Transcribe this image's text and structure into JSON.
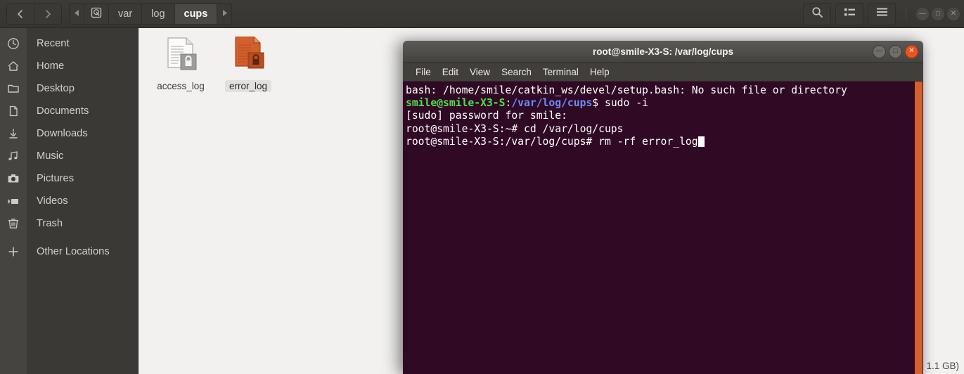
{
  "file_manager": {
    "nav": {
      "back_label": "Back",
      "forward_label": "Forward",
      "back_icon": "chevron-left-icon",
      "forward_icon": "chevron-right-icon"
    },
    "breadcrumb": {
      "scroll_left_icon": "triangle-left-icon",
      "scroll_right_icon": "triangle-right-icon",
      "root_icon": "drive-icon",
      "items": [
        {
          "label": "var",
          "active": false
        },
        {
          "label": "log",
          "active": false
        },
        {
          "label": "cups",
          "active": true
        }
      ]
    },
    "toolbar": {
      "search_icon": "search-icon",
      "view_list_icon": "view-list-icon",
      "menu_icon": "hamburger-menu-icon",
      "window_minimize": "—",
      "window_maximize": "□",
      "window_close": "✕"
    },
    "sidebar": {
      "items": [
        {
          "label": "Recent",
          "icon": "clock-icon"
        },
        {
          "label": "Home",
          "icon": "home-icon"
        },
        {
          "label": "Desktop",
          "icon": "folder-icon"
        },
        {
          "label": "Documents",
          "icon": "document-icon"
        },
        {
          "label": "Downloads",
          "icon": "download-icon"
        },
        {
          "label": "Music",
          "icon": "music-note-icon"
        },
        {
          "label": "Pictures",
          "icon": "camera-icon"
        },
        {
          "label": "Videos",
          "icon": "video-icon"
        },
        {
          "label": "Trash",
          "icon": "trash-icon"
        },
        {
          "label": "Other Locations",
          "icon": "plus-icon"
        }
      ]
    },
    "files": [
      {
        "name": "access_log",
        "type": "locked-text-file",
        "color": "#b7b5b0",
        "selected": false
      },
      {
        "name": "error_log",
        "type": "locked-text-file",
        "color": "#d35f2c",
        "selected": true
      }
    ],
    "status_text": "1.1 GB)"
  },
  "terminal": {
    "title": "root@smile-X3-S: /var/log/cups",
    "window_buttons": {
      "minimize": "—",
      "maximize": "□",
      "close": "✕"
    },
    "menu": [
      "File",
      "Edit",
      "View",
      "Search",
      "Terminal",
      "Help"
    ],
    "lines": [
      {
        "segments": [
          {
            "text": "bash: /home/smile/catkin_ws/devel/setup.bash: No such file or directory",
            "style": "plain"
          }
        ]
      },
      {
        "segments": [
          {
            "text": "smile@smile-X3-S",
            "style": "green"
          },
          {
            "text": ":",
            "style": "plain"
          },
          {
            "text": "/var/log/cups",
            "style": "blue"
          },
          {
            "text": "$ sudo -i",
            "style": "plain"
          }
        ]
      },
      {
        "segments": [
          {
            "text": "[sudo] password for smile:",
            "style": "plain"
          }
        ]
      },
      {
        "segments": [
          {
            "text": "root@smile-X3-S:~# cd /var/log/cups",
            "style": "plain"
          }
        ]
      },
      {
        "segments": [
          {
            "text": "root@smile-X3-S:/var/log/cups# rm -rf error_log",
            "style": "plain"
          },
          {
            "text": "",
            "style": "cursor"
          }
        ]
      }
    ],
    "colors": {
      "background": "#300a24",
      "foreground": "#ffffff",
      "prompt_user": "#4ee24e",
      "prompt_path": "#6a8cff",
      "scrollbar": "#d4602b",
      "close_button": "#e95420"
    }
  }
}
